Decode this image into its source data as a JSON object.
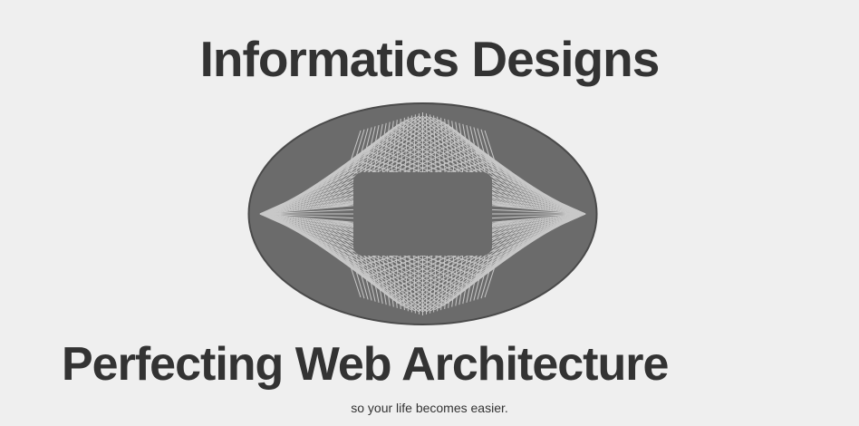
{
  "page": {
    "title": "Informatics Designs",
    "headline": "Perfecting Web Architecture",
    "tagline": "so your life becomes easier."
  },
  "logo": {
    "icon": "string-art-ellipse-logo",
    "fill_color": "#6b6b6b",
    "line_color": "#d9d9d9"
  }
}
